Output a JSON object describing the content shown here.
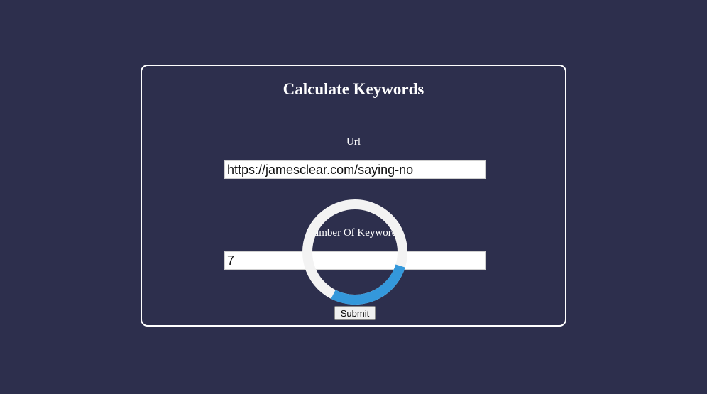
{
  "form": {
    "title": "Calculate Keywords",
    "url_label": "Url",
    "url_value": "https://jamesclear.com/saying-no",
    "keywords_label": "Number Of Keywords",
    "keywords_value": "7",
    "submit_label": "Submit"
  },
  "loader": {
    "icon": "loading-spinner-icon",
    "track_color": "#f3f3f3",
    "arc_color": "#3498db"
  },
  "colors": {
    "background": "#2d2f4d",
    "text": "#ffffff"
  }
}
